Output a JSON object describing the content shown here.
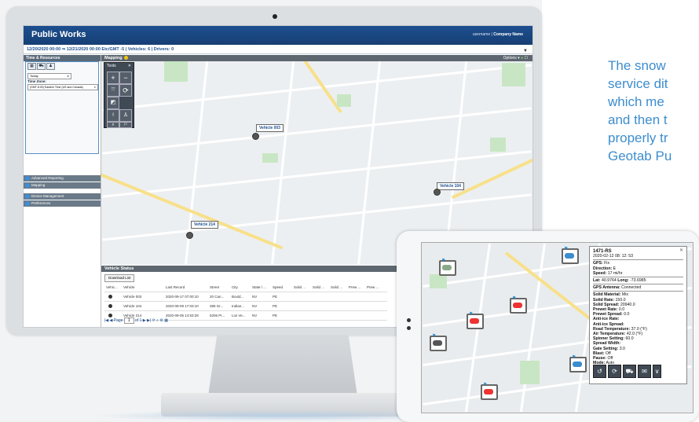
{
  "app": {
    "title": "Public Works",
    "user": "username",
    "separator": "|",
    "company": "Company Name",
    "date_range": "12/20/2020 00:00 ⇒ 12/21/2020 00:00 Etc/GMT -5 | Vehicles: 6 | Drivers: 0"
  },
  "left_panel": {
    "header": "Time & Resources",
    "select1": "Today",
    "timezone_label": "Time Zone:",
    "timezone_value": "(GMT-5:00) Eastern Time (US and Canada)",
    "sections": [
      "Advanced Reporting",
      "Mapping",
      "Device Management",
      "Preferences"
    ]
  },
  "map": {
    "header": "Mapping",
    "options": "Options ▾",
    "tools_header": "Tools",
    "vehicles": [
      {
        "label": "Vehicle 003"
      },
      {
        "label": "Vehicle 104"
      },
      {
        "label": "Vehicle 214"
      }
    ]
  },
  "vehicle_status": {
    "header": "Vehicle Status",
    "download": "Download List",
    "columns": [
      "Vehic...",
      "Vehicle",
      "Last Record",
      "Street",
      "City",
      "State / ...",
      "Speed",
      "Solid ...",
      "Solid ...",
      "Solid ...",
      "Prew ...",
      "Prew ..."
    ],
    "rows": [
      {
        "vehicle": "Vehicle 003",
        "last": "2020-09-17 07:00:10",
        "street": "20 Can...",
        "city": "Bould...",
        "state": "NV",
        "speed": "PE"
      },
      {
        "vehicle": "Vehicle 104",
        "last": "2020-09-09 17:03:10",
        "street": "385 Gr...",
        "city": "Indian...",
        "state": "NV",
        "speed": "PE"
      },
      {
        "vehicle": "Vehicle 214",
        "last": "2020-09-05 14:53:28",
        "street": "5206 Pr...",
        "city": "Los Ve...",
        "state": "NV",
        "speed": "PE"
      }
    ],
    "pager": {
      "page_label": "Page",
      "page_value": "1",
      "of": "of 1"
    }
  },
  "description": {
    "lines": [
      "The snow",
      "service dit",
      "which me",
      "and then t",
      "properly tr",
      "Geotab Pu"
    ]
  },
  "popup": {
    "title": "1471-RS",
    "datetime": "2020-02-12 08: 12: 53",
    "gps_label": "GPS:",
    "gps": "Fix",
    "direction_label": "Direction:",
    "direction": "E",
    "speed_label": "Speed:",
    "speed": "17 mi/hr",
    "lat_label": "Lat:",
    "lat": "40.9764",
    "long_label": "Long:",
    "long": "-73.6985",
    "antenna_label": "GPS Antenna:",
    "antenna": "Connected",
    "fields": [
      {
        "k": "Solid Material:",
        "v": "Mix"
      },
      {
        "k": "Solid Rate:",
        "v": "150.0"
      },
      {
        "k": "Solid Spread:",
        "v": "20940.0"
      },
      {
        "k": "Prewet Rate:",
        "v": "0.0"
      },
      {
        "k": "Prewet Spread:",
        "v": "0.0"
      },
      {
        "k": "Anti-ice Rate:",
        "v": ""
      },
      {
        "k": "Anti-ice Spread:",
        "v": ""
      },
      {
        "k": "Road Temperature:",
        "v": "37.0 (°F)"
      },
      {
        "k": "Air Temperature:",
        "v": "42.0 (°F)"
      },
      {
        "k": "Spinner Setting:",
        "v": "60.0"
      },
      {
        "k": "Spread Width:",
        "v": ""
      },
      {
        "k": "Gate Setting:",
        "v": "3.0"
      },
      {
        "k": "Blast:",
        "v": "Off"
      },
      {
        "k": "Pause:",
        "v": "Off"
      },
      {
        "k": "Mode:",
        "v": "Auto"
      }
    ]
  },
  "colors": {
    "brand": "#1d4f8f",
    "accent": "#3c8dce"
  }
}
